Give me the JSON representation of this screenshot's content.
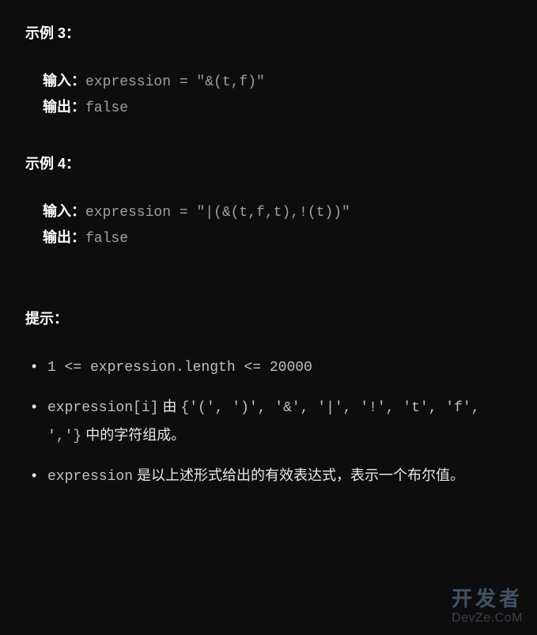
{
  "example3": {
    "header": "示例 3：",
    "inputLabel": "输入：",
    "inputContent": "expression = \"&(t,f)\"",
    "outputLabel": "输出：",
    "outputContent": "false"
  },
  "example4": {
    "header": "示例 4：",
    "inputLabel": "输入：",
    "inputContent": "expression = \"|(&(t,f,t),!(t))\"",
    "outputLabel": "输出：",
    "outputContent": "false"
  },
  "hints": {
    "header": "提示：",
    "item1": "1 <= expression.length <= 20000",
    "item2_code1": "expression[i]",
    "item2_text1": " 由 ",
    "item2_code2": "{'(', ')', '&', '|', '!', 't', 'f', ','}",
    "item2_text2": " 中的字符组成。",
    "item3_code": "expression",
    "item3_text": " 是以上述形式给出的有效表达式，表示一个布尔值。"
  },
  "watermark": {
    "cn": "开发者",
    "en": "DevZe.CoM"
  }
}
